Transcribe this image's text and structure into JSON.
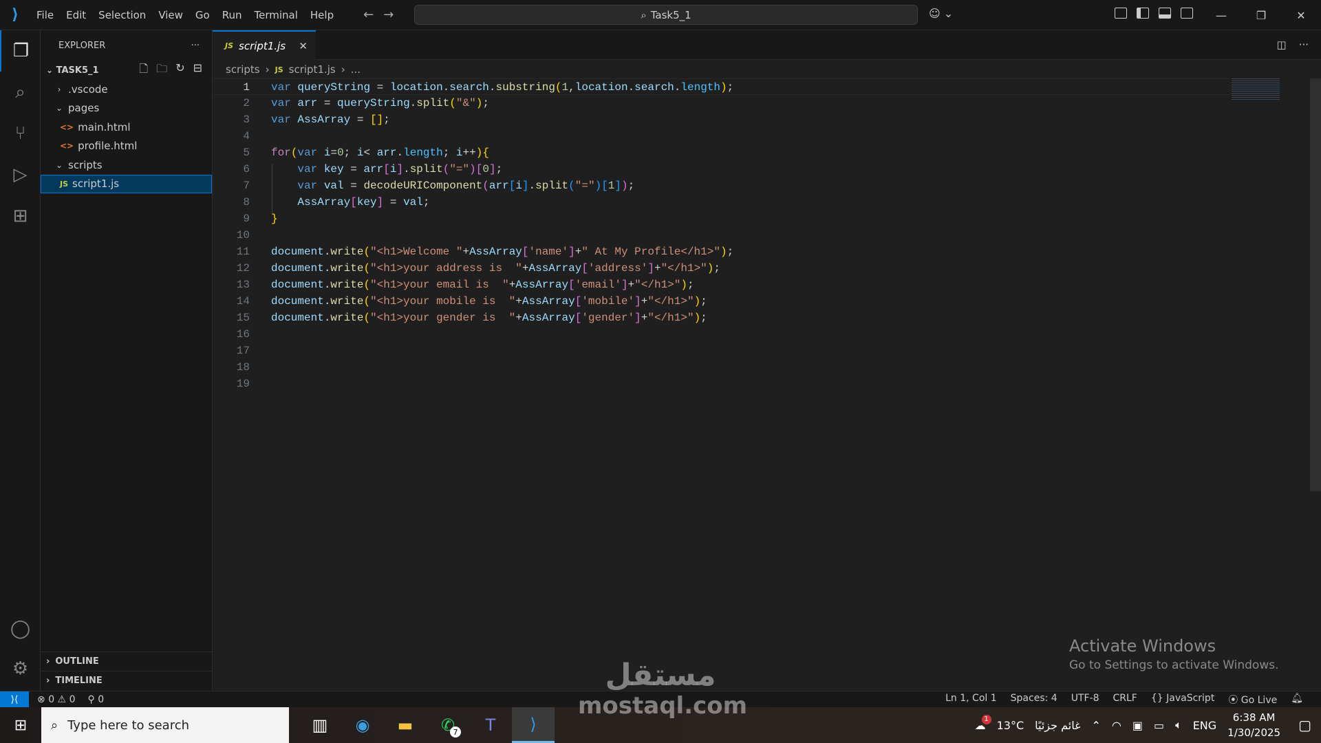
{
  "titlebar": {
    "menu": [
      "File",
      "Edit",
      "Selection",
      "View",
      "Go",
      "Run",
      "Terminal",
      "Help"
    ],
    "search": "Task5_1"
  },
  "explorer": {
    "title": "EXPLORER",
    "project": "TASK5_1",
    "tree": [
      {
        "label": ".vscode",
        "type": "folder",
        "open": false,
        "depth": 1
      },
      {
        "label": "pages",
        "type": "folder",
        "open": true,
        "depth": 1
      },
      {
        "label": "main.html",
        "type": "html",
        "depth": 2
      },
      {
        "label": "profile.html",
        "type": "html",
        "depth": 2
      },
      {
        "label": "scripts",
        "type": "folder",
        "open": true,
        "depth": 1
      },
      {
        "label": "script1.js",
        "type": "js",
        "depth": 2,
        "selected": true
      }
    ],
    "outline": "OUTLINE",
    "timeline": "TIMELINE"
  },
  "tab": {
    "icon": "JS",
    "label": "script1.js"
  },
  "breadcrumb": {
    "folder": "scripts",
    "icon": "JS",
    "file": "script1.js",
    "more": "..."
  },
  "code": [
    [
      [
        "k",
        "var"
      ],
      [
        "p",
        " "
      ],
      [
        "v",
        "queryString"
      ],
      [
        "p",
        " = "
      ],
      [
        "v",
        "location"
      ],
      [
        "p",
        "."
      ],
      [
        "v",
        "search"
      ],
      [
        "p",
        "."
      ],
      [
        "f",
        "substring"
      ],
      [
        "b1",
        "("
      ],
      [
        "n",
        "1"
      ],
      [
        "p",
        ","
      ],
      [
        "v",
        "location"
      ],
      [
        "p",
        "."
      ],
      [
        "v",
        "search"
      ],
      [
        "p",
        "."
      ],
      [
        "cn",
        "length"
      ],
      [
        "b1",
        ")"
      ],
      [
        "p",
        ";"
      ]
    ],
    [
      [
        "k",
        "var"
      ],
      [
        "p",
        " "
      ],
      [
        "v",
        "arr"
      ],
      [
        "p",
        " = "
      ],
      [
        "v",
        "queryString"
      ],
      [
        "p",
        "."
      ],
      [
        "f",
        "split"
      ],
      [
        "b1",
        "("
      ],
      [
        "s",
        "\"&\""
      ],
      [
        "b1",
        ")"
      ],
      [
        "p",
        ";"
      ]
    ],
    [
      [
        "k",
        "var"
      ],
      [
        "p",
        " "
      ],
      [
        "v",
        "AssArray"
      ],
      [
        "p",
        " = "
      ],
      [
        "b1",
        "[]"
      ],
      [
        "p",
        ";"
      ]
    ],
    [],
    [
      [
        "c",
        "for"
      ],
      [
        "b1",
        "("
      ],
      [
        "k",
        "var"
      ],
      [
        "p",
        " "
      ],
      [
        "v",
        "i"
      ],
      [
        "p",
        "="
      ],
      [
        "n",
        "0"
      ],
      [
        "p",
        "; "
      ],
      [
        "v",
        "i"
      ],
      [
        "p",
        "< "
      ],
      [
        "v",
        "arr"
      ],
      [
        "p",
        "."
      ],
      [
        "cn",
        "length"
      ],
      [
        "p",
        "; "
      ],
      [
        "v",
        "i"
      ],
      [
        "p",
        "++"
      ],
      [
        "b1",
        ")"
      ],
      [
        "b1",
        "{"
      ]
    ],
    [
      [
        "p",
        "    "
      ],
      [
        "k",
        "var"
      ],
      [
        "p",
        " "
      ],
      [
        "v",
        "key"
      ],
      [
        "p",
        " = "
      ],
      [
        "v",
        "arr"
      ],
      [
        "b2",
        "["
      ],
      [
        "v",
        "i"
      ],
      [
        "b2",
        "]"
      ],
      [
        "p",
        "."
      ],
      [
        "f",
        "split"
      ],
      [
        "b2",
        "("
      ],
      [
        "s",
        "\"=\""
      ],
      [
        "b2",
        ")"
      ],
      [
        "b2",
        "["
      ],
      [
        "n",
        "0"
      ],
      [
        "b2",
        "]"
      ],
      [
        "p",
        ";"
      ]
    ],
    [
      [
        "p",
        "    "
      ],
      [
        "k",
        "var"
      ],
      [
        "p",
        " "
      ],
      [
        "v",
        "val"
      ],
      [
        "p",
        " = "
      ],
      [
        "f",
        "decodeURIComponent"
      ],
      [
        "b2",
        "("
      ],
      [
        "v",
        "arr"
      ],
      [
        "b3",
        "["
      ],
      [
        "v",
        "i"
      ],
      [
        "b3",
        "]"
      ],
      [
        "p",
        "."
      ],
      [
        "f",
        "split"
      ],
      [
        "b3",
        "("
      ],
      [
        "s",
        "\"=\""
      ],
      [
        "b3",
        ")"
      ],
      [
        "b3",
        "["
      ],
      [
        "n",
        "1"
      ],
      [
        "b3",
        "]"
      ],
      [
        "b2",
        ")"
      ],
      [
        "p",
        ";"
      ]
    ],
    [
      [
        "p",
        "    "
      ],
      [
        "v",
        "AssArray"
      ],
      [
        "b2",
        "["
      ],
      [
        "v",
        "key"
      ],
      [
        "b2",
        "]"
      ],
      [
        "p",
        " = "
      ],
      [
        "v",
        "val"
      ],
      [
        "p",
        ";"
      ]
    ],
    [
      [
        "b1",
        "}"
      ]
    ],
    [],
    [
      [
        "v",
        "document"
      ],
      [
        "p",
        "."
      ],
      [
        "f",
        "write"
      ],
      [
        "b1",
        "("
      ],
      [
        "s",
        "\"<h1>Welcome \""
      ],
      [
        "p",
        "+"
      ],
      [
        "v",
        "AssArray"
      ],
      [
        "b2",
        "["
      ],
      [
        "s",
        "'name'"
      ],
      [
        "b2",
        "]"
      ],
      [
        "p",
        "+"
      ],
      [
        "s",
        "\" At My Profile</h1>\""
      ],
      [
        "b1",
        ")"
      ],
      [
        "p",
        ";"
      ]
    ],
    [
      [
        "v",
        "document"
      ],
      [
        "p",
        "."
      ],
      [
        "f",
        "write"
      ],
      [
        "b1",
        "("
      ],
      [
        "s",
        "\"<h1>your address is  \""
      ],
      [
        "p",
        "+"
      ],
      [
        "v",
        "AssArray"
      ],
      [
        "b2",
        "["
      ],
      [
        "s",
        "'address'"
      ],
      [
        "b2",
        "]"
      ],
      [
        "p",
        "+"
      ],
      [
        "s",
        "\"</h1>\""
      ],
      [
        "b1",
        ")"
      ],
      [
        "p",
        ";"
      ]
    ],
    [
      [
        "v",
        "document"
      ],
      [
        "p",
        "."
      ],
      [
        "f",
        "write"
      ],
      [
        "b1",
        "("
      ],
      [
        "s",
        "\"<h1>your email is  \""
      ],
      [
        "p",
        "+"
      ],
      [
        "v",
        "AssArray"
      ],
      [
        "b2",
        "["
      ],
      [
        "s",
        "'email'"
      ],
      [
        "b2",
        "]"
      ],
      [
        "p",
        "+"
      ],
      [
        "s",
        "\"</h1>\""
      ],
      [
        "b1",
        ")"
      ],
      [
        "p",
        ";"
      ]
    ],
    [
      [
        "v",
        "document"
      ],
      [
        "p",
        "."
      ],
      [
        "f",
        "write"
      ],
      [
        "b1",
        "("
      ],
      [
        "s",
        "\"<h1>your mobile is  \""
      ],
      [
        "p",
        "+"
      ],
      [
        "v",
        "AssArray"
      ],
      [
        "b2",
        "["
      ],
      [
        "s",
        "'mobile'"
      ],
      [
        "b2",
        "]"
      ],
      [
        "p",
        "+"
      ],
      [
        "s",
        "\"</h1>\""
      ],
      [
        "b1",
        ")"
      ],
      [
        "p",
        ";"
      ]
    ],
    [
      [
        "v",
        "document"
      ],
      [
        "p",
        "."
      ],
      [
        "f",
        "write"
      ],
      [
        "b1",
        "("
      ],
      [
        "s",
        "\"<h1>your gender is  \""
      ],
      [
        "p",
        "+"
      ],
      [
        "v",
        "AssArray"
      ],
      [
        "b2",
        "["
      ],
      [
        "s",
        "'gender'"
      ],
      [
        "b2",
        "]"
      ],
      [
        "p",
        "+"
      ],
      [
        "s",
        "\"</h1>\""
      ],
      [
        "b1",
        ")"
      ],
      [
        "p",
        ";"
      ]
    ],
    [],
    [],
    [],
    []
  ],
  "statusbar": {
    "errors": "0",
    "warnings": "0",
    "ports": "0",
    "position": "Ln 1, Col 1",
    "spaces": "Spaces: 4",
    "encoding": "UTF-8",
    "eol": "CRLF",
    "language": "JavaScript",
    "golive": "Go Live"
  },
  "overlay": {
    "activate_title": "Activate Windows",
    "activate_sub": "Go to Settings to activate Windows.",
    "watermark_ar": "مستقل",
    "watermark": "mostaql.com"
  },
  "taskbar": {
    "search_placeholder": "Type here to search",
    "whatsapp_badge": "7",
    "weather_badge": "1",
    "temperature": "13°C",
    "weather": "غائم جزئيًا",
    "lang": "ENG",
    "time": "6:38 AM",
    "date": "1/30/2025"
  },
  "colors": {
    "accent": "#0078d4",
    "editor_bg": "#1f1f1f",
    "sidebar_bg": "#181818"
  }
}
